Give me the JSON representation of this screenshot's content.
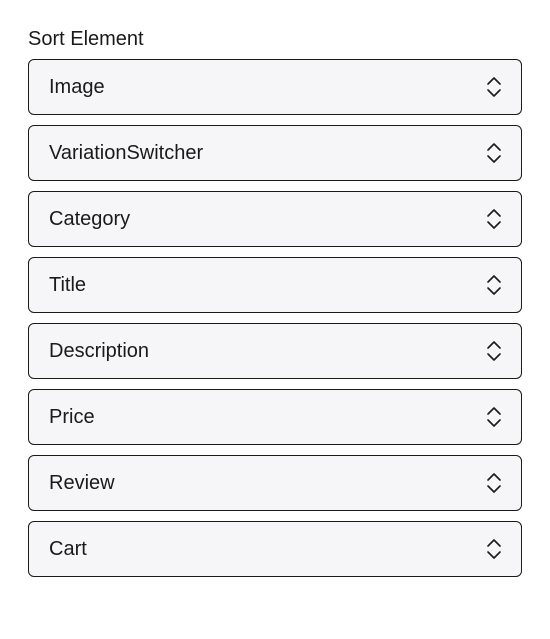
{
  "section": {
    "title": "Sort Element"
  },
  "items": [
    {
      "label": "Image",
      "name": "image"
    },
    {
      "label": "VariationSwitcher",
      "name": "variation-switcher"
    },
    {
      "label": "Category",
      "name": "category"
    },
    {
      "label": "Title",
      "name": "title"
    },
    {
      "label": "Description",
      "name": "description"
    },
    {
      "label": "Price",
      "name": "price"
    },
    {
      "label": "Review",
      "name": "review"
    },
    {
      "label": "Cart",
      "name": "cart"
    }
  ]
}
